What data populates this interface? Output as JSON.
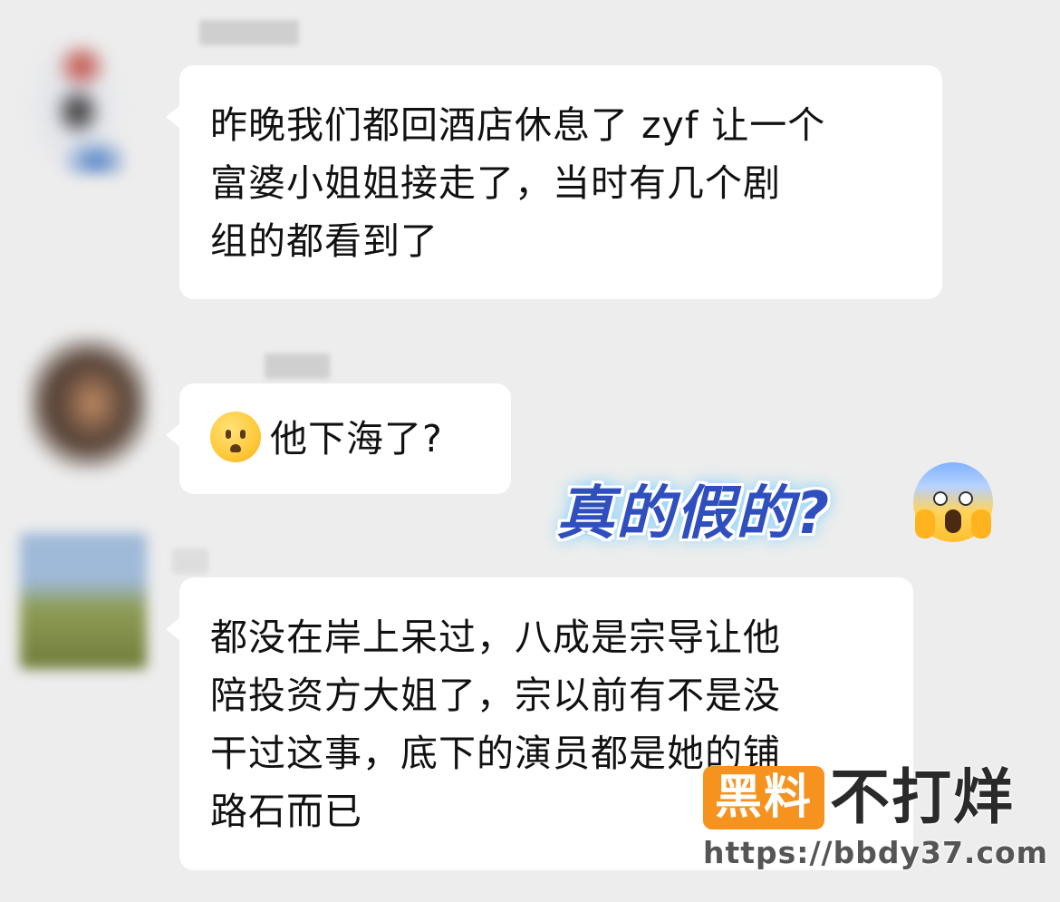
{
  "messages": [
    {
      "lines": [
        "昨晚我们都回酒店休息了 zyf 让一个",
        "富婆小姐姐接走了，当时有几个剧",
        "组的都看到了"
      ]
    },
    {
      "emoji": "worried-face-icon",
      "text": "他下海了?"
    },
    {
      "lines": [
        "都没在岸上呆过，八成是宗导让他",
        "陪投资方大姐了，宗以前有不是没",
        "干过这事，底下的演员都是她的铺",
        "路石而已"
      ]
    }
  ],
  "overlay": {
    "caption": "真的假的?",
    "emoji": "face-screaming-in-fear-icon"
  },
  "watermark": {
    "badge": "黑料",
    "brand": "不打烊",
    "url": "https://bbdy37.com",
    "badge_color": "#f6921e"
  },
  "colors": {
    "background": "#ededed",
    "bubble": "#ffffff",
    "caption": "#2f4fbf"
  }
}
